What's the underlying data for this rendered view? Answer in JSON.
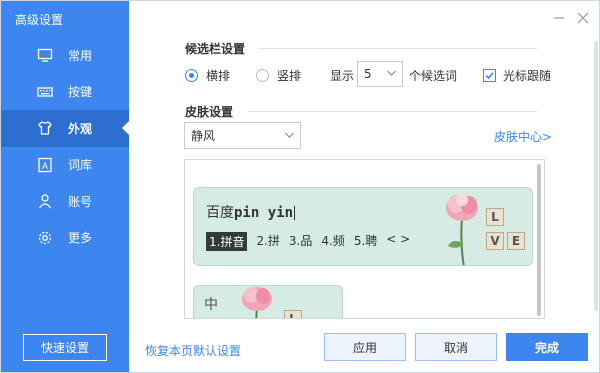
{
  "app": {
    "title": "高级设置"
  },
  "sidebar": {
    "items": [
      {
        "label": "常用",
        "icon": "monitor-icon",
        "active": false
      },
      {
        "label": "按键",
        "icon": "keyboard-icon",
        "active": false
      },
      {
        "label": "外观",
        "icon": "tshirt-icon",
        "active": true
      },
      {
        "label": "词库",
        "icon": "dictionary-icon",
        "active": false
      },
      {
        "label": "账号",
        "icon": "user-icon",
        "active": false
      },
      {
        "label": "更多",
        "icon": "gear-icon",
        "active": false
      }
    ],
    "quick_settings_label": "快速设置"
  },
  "candidate_bar": {
    "section_title": "候选栏设置",
    "orientation_options": [
      {
        "label": "横排",
        "selected": true
      },
      {
        "label": "竖排",
        "selected": false
      }
    ],
    "display_label": "显示",
    "count_value": "5",
    "count_suffix": "个候选词",
    "follow_cursor_label": "光标跟随",
    "follow_cursor_checked": true
  },
  "skin": {
    "section_title": "皮肤设置",
    "selected_skin": "静风",
    "skin_center_link": "皮肤中心>",
    "preview": {
      "input_prefix": "百度",
      "input_pinyin": "pin yin",
      "candidates": [
        "1.拼音",
        "2.拼",
        "3.品",
        "4.频",
        "5.聘"
      ],
      "nav_arrows": "< >",
      "tiles": [
        "L",
        "V",
        "E"
      ],
      "second_skin_char": "中"
    }
  },
  "footer": {
    "restore_default_link": "恢复本页默认设置",
    "apply_label": "应用",
    "cancel_label": "取消",
    "done_label": "完成"
  },
  "colors": {
    "accent": "#3d86f0",
    "sidebar_active": "#2d6fd1",
    "skin_bg": "#d6ebe3"
  }
}
